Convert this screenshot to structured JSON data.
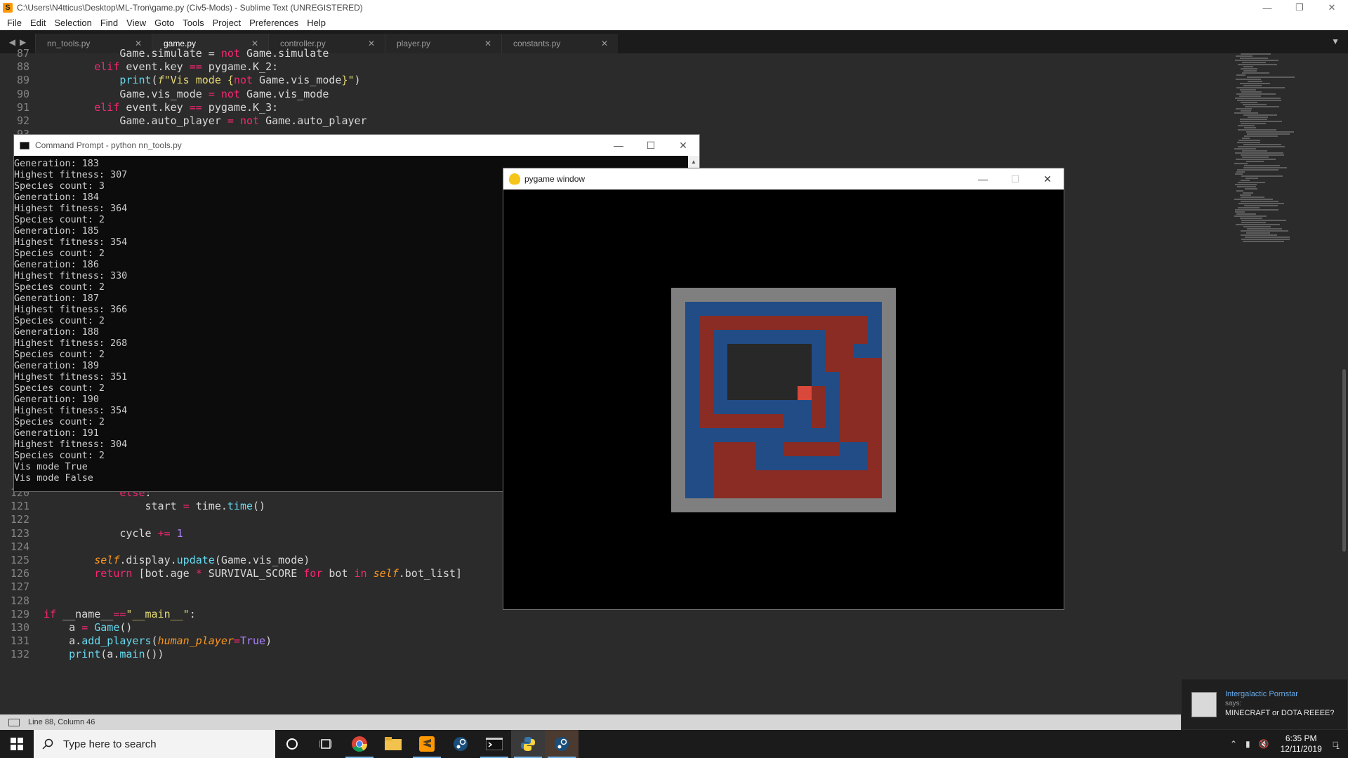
{
  "sublime": {
    "window_title": "C:\\Users\\N4tticus\\Desktop\\ML-Tron\\game.py (Civ5-Mods) - Sublime Text (UNREGISTERED)",
    "menu": [
      "File",
      "Edit",
      "Selection",
      "Find",
      "View",
      "Goto",
      "Tools",
      "Project",
      "Preferences",
      "Help"
    ],
    "tabs": [
      {
        "label": "nn_tools.py",
        "active": false
      },
      {
        "label": "game.py",
        "active": true
      },
      {
        "label": "controller.py",
        "active": false
      },
      {
        "label": "player.py",
        "active": false
      },
      {
        "label": "constants.py",
        "active": false
      }
    ],
    "status_text": "Line 88, Column 46",
    "code_top": [
      {
        "n": "87",
        "html": "            Game.simulate = <span class=\"kw\">not</span> Game.simulate"
      },
      {
        "n": "88",
        "html": "        <span class=\"kw\">elif</span> event.key <span class=\"op\">==</span> pygame.K_2:"
      },
      {
        "n": "89",
        "html": "            <span class=\"fn\">print</span>(<span class=\"str\"><i>f</i>\"Vis mode {</span><span class=\"kw\">not</span> Game.vis_mode<span class=\"str\">}\"</span>)"
      },
      {
        "n": "90",
        "html": "            Game.vis_mode <span class=\"op\">=</span> <span class=\"kw\">not</span> Game.vis_mode"
      },
      {
        "n": "91",
        "html": "        <span class=\"kw\">elif</span> event.key <span class=\"op\">==</span> pygame.K_3:"
      },
      {
        "n": "92",
        "html": "            Game.auto_player <span class=\"op\">=</span> <span class=\"kw\">not</span> Game.auto_player"
      },
      {
        "n": "93",
        "html": ""
      }
    ],
    "code_bottom": [
      {
        "n": "120",
        "html": "            <span class=\"kw\">else</span>:"
      },
      {
        "n": "121",
        "html": "                start <span class=\"op\">=</span> time.<span class=\"fn\">time</span>()"
      },
      {
        "n": "122",
        "html": ""
      },
      {
        "n": "123",
        "html": "            cycle <span class=\"op\">+=</span> <span class=\"cons\">1</span>"
      },
      {
        "n": "124",
        "html": ""
      },
      {
        "n": "125",
        "html": "        <span class=\"self\">self</span>.display.<span class=\"fn\">update</span>(Game.vis_mode)"
      },
      {
        "n": "126",
        "html": "        <span class=\"kw\">return</span> [bot.age <span class=\"op\">*</span> SURVIVAL_SCORE <span class=\"kw\">for</span> bot <span class=\"kw\">in</span> <span class=\"self\">self</span>.bot_list]"
      },
      {
        "n": "127",
        "html": ""
      },
      {
        "n": "128",
        "html": ""
      },
      {
        "n": "129",
        "html": "<span class=\"kw\">if</span> __name__<span class=\"op\">==</span><span class=\"str\">\"__main__\"</span>:"
      },
      {
        "n": "130",
        "html": "    a <span class=\"op\">=</span> <span class=\"fn\">Game</span>()"
      },
      {
        "n": "131",
        "html": "    a.<span class=\"fn\">add_players</span>(<span class=\"arg\">human_player</span><span class=\"op\">=</span><span class=\"cons\">True</span>)"
      },
      {
        "n": "132",
        "html": "    <span class=\"fn\">print</span>(a.<span class=\"fn\">main</span>())"
      }
    ]
  },
  "cmd": {
    "title": "Command Prompt - python  nn_tools.py",
    "lines": [
      "Generation: 183",
      "Highest fitness: 307",
      "Species count: 3",
      "Generation: 184",
      "Highest fitness: 364",
      "Species count: 2",
      "Generation: 185",
      "Highest fitness: 354",
      "Species count: 2",
      "Generation: 186",
      "Highest fitness: 330",
      "Species count: 2",
      "Generation: 187",
      "Highest fitness: 366",
      "Species count: 2",
      "Generation: 188",
      "Highest fitness: 268",
      "Species count: 2",
      "Generation: 189",
      "Highest fitness: 351",
      "Species count: 2",
      "Generation: 190",
      "Highest fitness: 354",
      "Species count: 2",
      "Generation: 191",
      "Highest fitness: 304",
      "Species count: 2",
      "Vis mode True",
      "Vis mode False"
    ]
  },
  "pygame": {
    "title": "pygame window",
    "colors": {
      "border": "#7f7f7f",
      "blue": "#224c86",
      "red": "#8a2c24",
      "empty": "#282828",
      "head": "#d9493b"
    }
  },
  "taskbar": {
    "search_placeholder": "Type here to search",
    "time": "6:35 PM",
    "date": "12/11/2019",
    "notification_count": "1"
  },
  "toast": {
    "name": "Intergalactic Pornstar",
    "says": "says:",
    "message": "MINECRAFT or DOTA REEEE?"
  }
}
